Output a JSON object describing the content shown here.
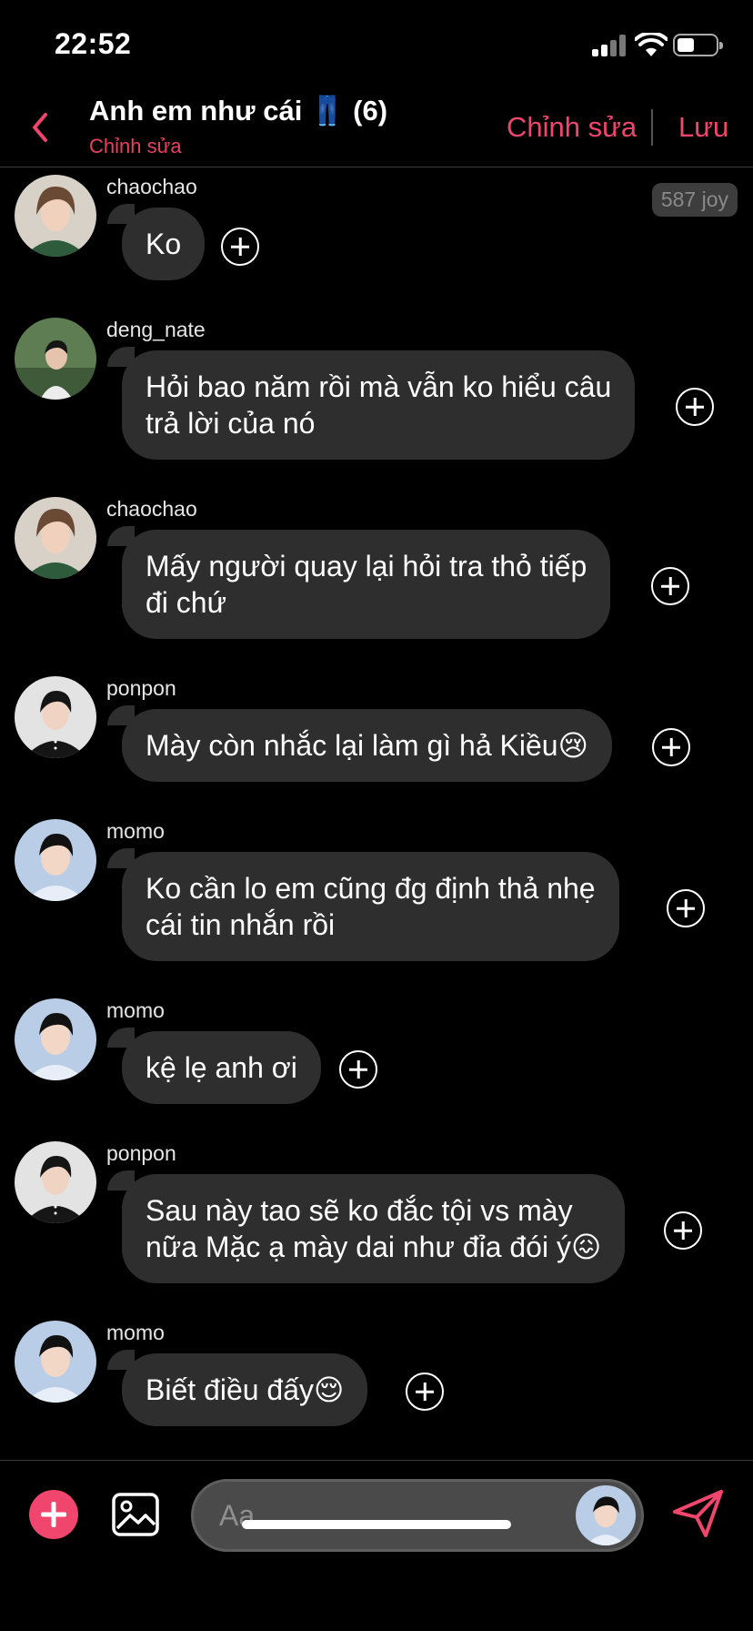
{
  "status_bar": {
    "time": "22:52",
    "battery_level": 0.45
  },
  "header": {
    "title": "Anh em như cái 👖 (6)",
    "subtitle": "Chỉnh sửa",
    "edit_label": "Chỉnh sửa",
    "save_label": "Lưu"
  },
  "badge": "587 joy",
  "messages": [
    {
      "sender": "chaochao",
      "text": "Ko",
      "avatar": "chaochao-avatar"
    },
    {
      "sender": "deng_nate",
      "text": "Hỏi bao năm rồi mà vẫn ko hiểu câu\ntrả lời của nó",
      "avatar": "deng-nate-avatar"
    },
    {
      "sender": "chaochao",
      "text": "Mấy người quay lại hỏi tra thỏ tiếp\nđi chứ",
      "avatar": "chaochao-avatar"
    },
    {
      "sender": "ponpon",
      "text": "Mày còn nhắc lại làm gì hả Kiều😢",
      "avatar": "ponpon-avatar"
    },
    {
      "sender": "momo",
      "text": "Ko cần lo em cũng đg định thả nhẹ\ncái tin nhắn rồi",
      "avatar": "momo-avatar"
    },
    {
      "sender": "momo",
      "text": "kệ lẹ anh ơi",
      "avatar": "momo-avatar"
    },
    {
      "sender": "ponpon",
      "text": "Sau này tao sẽ ko đắc tội vs mày\nnữa Mặc ạ mày dai như đỉa đói ý😖",
      "avatar": "ponpon-avatar"
    },
    {
      "sender": "momo",
      "text": "Biết điều đấy😌",
      "avatar": "momo-avatar"
    }
  ],
  "composer": {
    "placeholder": "Aa"
  },
  "colors": {
    "accent": "#f0466e",
    "bubble": "#2e2e2e",
    "background": "#000000"
  }
}
